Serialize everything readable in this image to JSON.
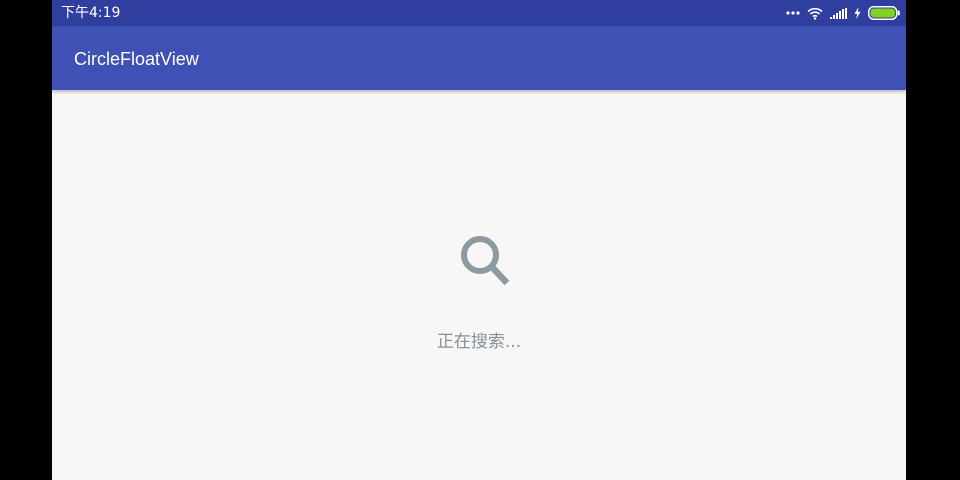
{
  "status_bar": {
    "time": "下午4:19",
    "icons": [
      "more-dots-icon",
      "wifi-icon",
      "signal-icon",
      "charging-icon",
      "battery-icon"
    ],
    "background_color": "#303f9f",
    "battery_color": "#7ed321"
  },
  "app_bar": {
    "title": "CircleFloatView",
    "background_color": "#3f51b5"
  },
  "content": {
    "icon": "search-icon",
    "icon_color": "#8c9aa1",
    "message": "正在搜索..."
  }
}
